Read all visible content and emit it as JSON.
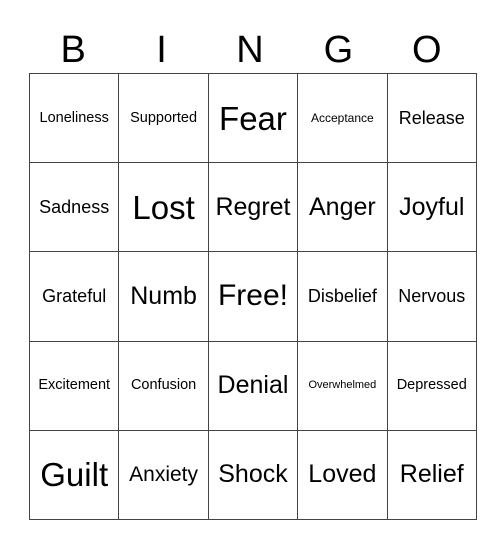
{
  "header": {
    "letters": [
      "B",
      "I",
      "N",
      "G",
      "O"
    ]
  },
  "grid": {
    "rows": [
      [
        "Loneliness",
        "Supported",
        "Fear",
        "Acceptance",
        "Release"
      ],
      [
        "Sadness",
        "Lost",
        "Regret",
        "Anger",
        "Joyful"
      ],
      [
        "Grateful",
        "Numb",
        "Free!",
        "Disbelief",
        "Nervous"
      ],
      [
        "Excitement",
        "Confusion",
        "Denial",
        "Overwhelmed",
        "Depressed"
      ],
      [
        "Guilt",
        "Anxiety",
        "Shock",
        "Loved",
        "Relief"
      ]
    ]
  },
  "colors": {
    "background": "#ffffff",
    "text": "#000000",
    "grid_line": "#444444"
  }
}
